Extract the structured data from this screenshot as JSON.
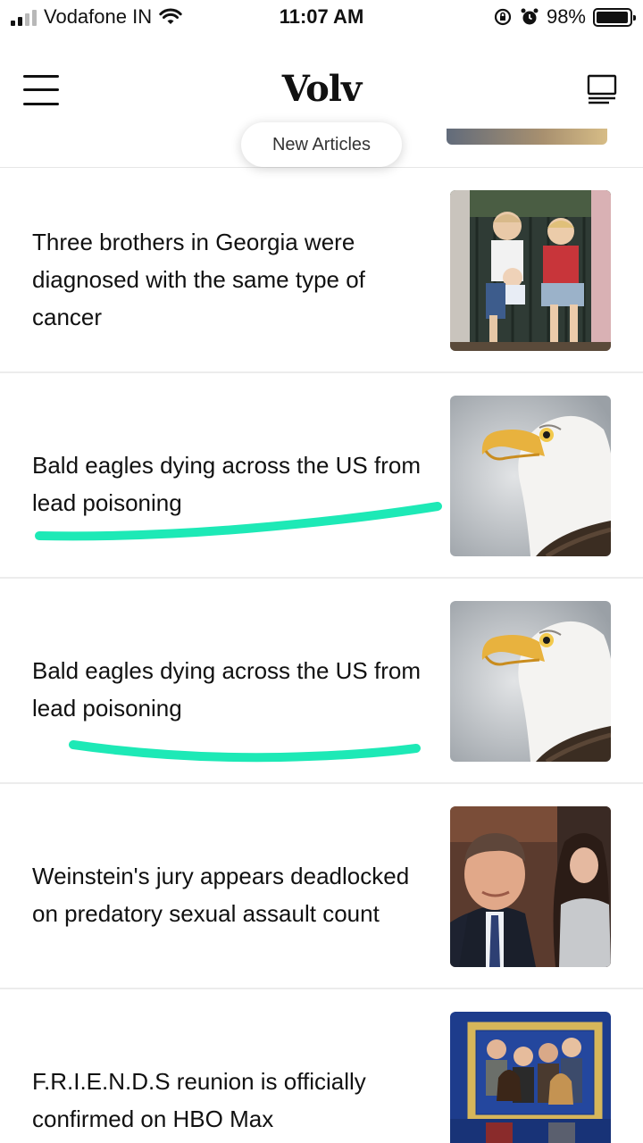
{
  "status_bar": {
    "carrier": "Vodafone IN",
    "time": "11:07 AM",
    "battery": "98%"
  },
  "header": {
    "logo": "Volv",
    "new_articles_label": "New Articles"
  },
  "articles": [
    {
      "title": "Three brothers in Georgia were diagnosed with the same type of cancer",
      "thumb": "family-photo"
    },
    {
      "title": "Bald eagles dying across the US from lead poisoning",
      "thumb": "bald-eagle"
    },
    {
      "title": "Bald eagles dying across the US from lead poisoning",
      "thumb": "bald-eagle"
    },
    {
      "title": "Weinstein's jury appears deadlocked on predatory sexual assault count",
      "thumb": "courtroom-portrait"
    },
    {
      "title": "F.R.I.E.N.D.S reunion is officially confirmed on HBO Max",
      "thumb": "cast-in-frame"
    }
  ],
  "colors": {
    "highlight": "#1de9b6",
    "divider": "#ececec"
  }
}
